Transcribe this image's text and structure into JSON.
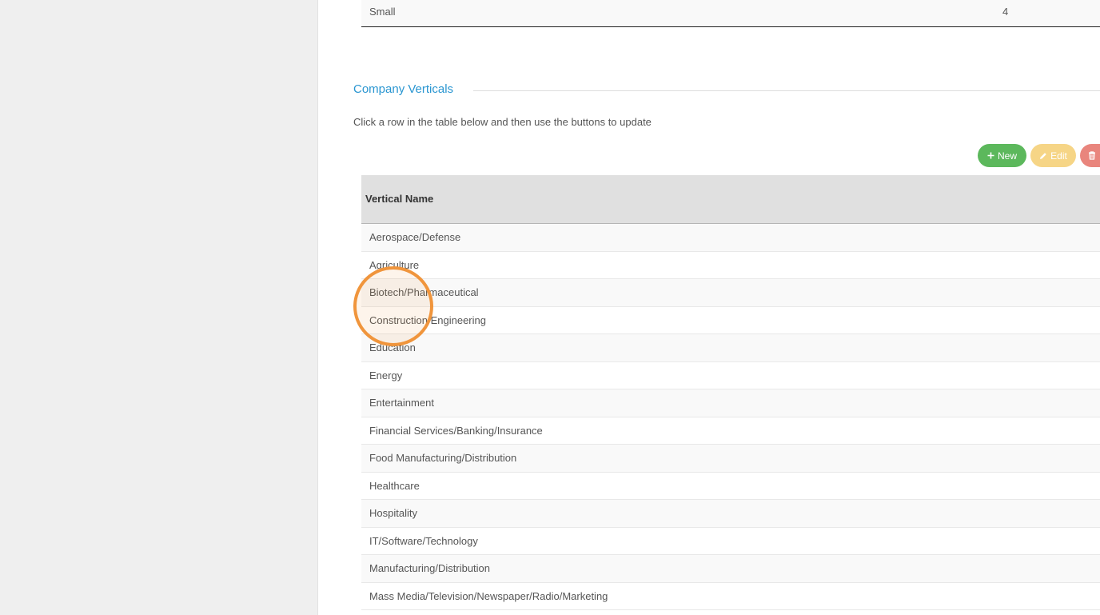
{
  "previous_table": {
    "row": {
      "name": "Small",
      "value": "4"
    }
  },
  "section": {
    "title": "Company Verticals",
    "help_text": "Click a row in the table below and then use the buttons to update"
  },
  "actions": {
    "new_label": "New",
    "edit_label": "Edit",
    "new_icon": "plus-icon",
    "edit_icon": "pencil-icon",
    "delete_icon": "trash-icon",
    "colors": {
      "new": "#5cb85c",
      "edit": "#f6d586",
      "delete": "#e9857d"
    }
  },
  "table": {
    "header": "Vertical Name",
    "rows": [
      "Aerospace/Defense",
      "Agriculture",
      "Biotech/Pharmaceutical",
      "Construction/Engineering",
      "Education",
      "Energy",
      "Entertainment",
      "Financial Services/Banking/Insurance",
      "Food Manufacturing/Distribution",
      "Healthcare",
      "Hospitality",
      "IT/Software/Technology",
      "Manufacturing/Distribution",
      "Mass Media/Television/Newspaper/Radio/Marketing"
    ]
  },
  "accent_color": "#2a96d1",
  "click_highlight_color": "#f0953c"
}
